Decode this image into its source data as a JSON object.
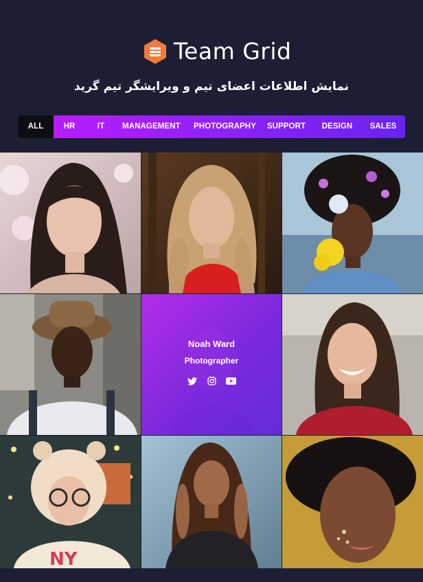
{
  "header": {
    "title": "Team Grid",
    "subtitle": "نمایش اطلاعات اعضای تیم و ویرایشگر تیم گرید",
    "logo_icon": "team-grid-logo-icon",
    "logo_color": "#f07b3f"
  },
  "filters": {
    "items": [
      {
        "label": "ALL",
        "active": true
      },
      {
        "label": "HR"
      },
      {
        "label": "IT"
      },
      {
        "label": "MANAGEMENT"
      },
      {
        "label": "PHOTOGRAPHY"
      },
      {
        "label": "SUPPORT"
      },
      {
        "label": "DESIGN"
      },
      {
        "label": "SALES"
      }
    ],
    "gradient_start": "#c21bff",
    "gradient_end": "#6a23ef"
  },
  "team": {
    "hovered_member": {
      "name": "Noah Ward",
      "role": "Photographer",
      "social": [
        "twitter-icon",
        "instagram-icon",
        "youtube-icon"
      ]
    },
    "overlay_color": "#9a2ff2"
  }
}
